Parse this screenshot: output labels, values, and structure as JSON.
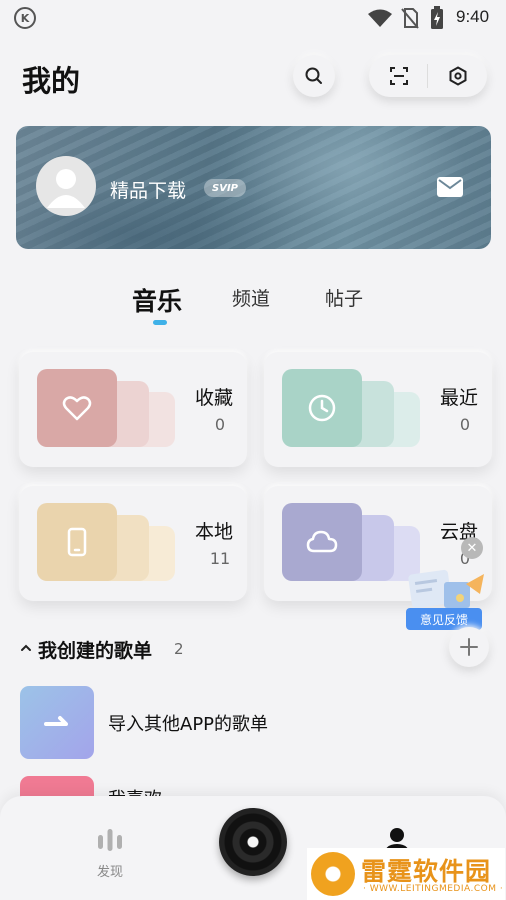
{
  "status_bar": {
    "time": "9:40",
    "app_icon_letter": "K"
  },
  "header": {
    "title": "我的",
    "icons": [
      "search-icon",
      "scan-icon",
      "settings-icon"
    ]
  },
  "profile": {
    "username": "精品下载",
    "badge": "SVIP",
    "mail_icon": "mail-icon"
  },
  "tabs": [
    {
      "label": "音乐",
      "active": true
    },
    {
      "label": "频道",
      "active": false
    },
    {
      "label": "帖子",
      "active": false
    }
  ],
  "cards": [
    {
      "label": "收藏",
      "count": "0",
      "icon": "heart-icon",
      "color": "#d9a6a6"
    },
    {
      "label": "最近",
      "count": "0",
      "icon": "clock-icon",
      "color": "#a9d3c7"
    },
    {
      "label": "本地",
      "count": "11",
      "icon": "phone-icon",
      "color": "#ead4ad"
    },
    {
      "label": "云盘",
      "count": "0",
      "icon": "cloud-icon",
      "color": "#a9a9d0"
    }
  ],
  "feedback": {
    "label": "意见反馈"
  },
  "playlists": {
    "heading": "我创建的歌单",
    "count": "2",
    "items": [
      {
        "label": "导入其他APP的歌单"
      },
      {
        "label": "我喜欢"
      }
    ]
  },
  "bottom_nav": {
    "discover_label": "发现"
  },
  "watermark": {
    "title": "雷霆软件园",
    "url": "· WWW.LEITINGMEDIA.COM ·"
  },
  "colors": {
    "accent": "#3fb1e8",
    "feedback_blue": "#4a8ff0",
    "favorite_pink": "#f07a93"
  }
}
